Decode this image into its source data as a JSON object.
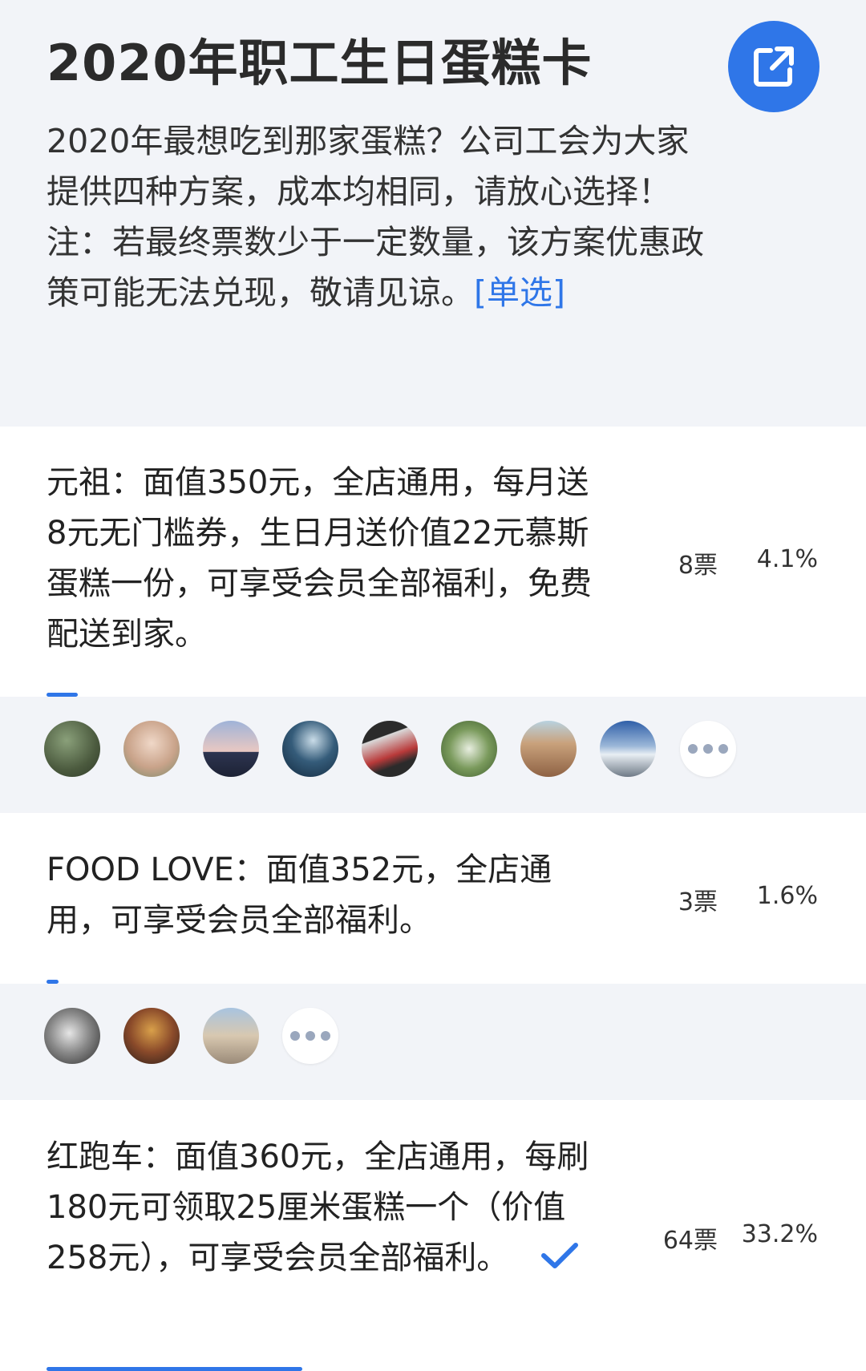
{
  "poll": {
    "title": "2020年职工生日蛋糕卡",
    "description": "2020年最想吃到那家蛋糕？公司工会为大家提供四种方案，成本均相同，请放心选择！注：若最终票数少于一定数量，该方案优惠政策可能无法兑现，敬请见谅。",
    "type_tag": "[单选]",
    "share_icon": "external-link-icon"
  },
  "options": [
    {
      "text": "元祖：面值350元，全店通用，每月送8元无门槛券，生日月送价值22元慕斯蛋糕一份，可享受会员全部福利，免费配送到家。",
      "votes": "8票",
      "percent": "4.1%",
      "share": 0.041,
      "selected": false,
      "voter_avatars": [
        "avatar-garden",
        "avatar-couple",
        "avatar-girl-sunset",
        "avatar-wave",
        "avatar-red-object",
        "avatar-flowers",
        "avatar-desert",
        "avatar-mountain"
      ]
    },
    {
      "text": "FOOD LOVE：面值352元，全店通用，可享受会员全部福利。",
      "votes": "3票",
      "percent": "1.6%",
      "share": 0.016,
      "selected": false,
      "voter_avatars": [
        "avatar-car",
        "avatar-player",
        "avatar-rock"
      ]
    },
    {
      "text": "红跑车：面值360元，全店通用，每刷180元可领取25厘米蛋糕一个（价值258元），可享受会员全部福利。",
      "votes": "64票",
      "percent": "33.2%",
      "share": 0.332,
      "selected": true,
      "check_icon": "checkmark-icon"
    }
  ],
  "colors": {
    "accent": "#2f76e8",
    "background": "#f2f4f8",
    "card": "#ffffff"
  }
}
